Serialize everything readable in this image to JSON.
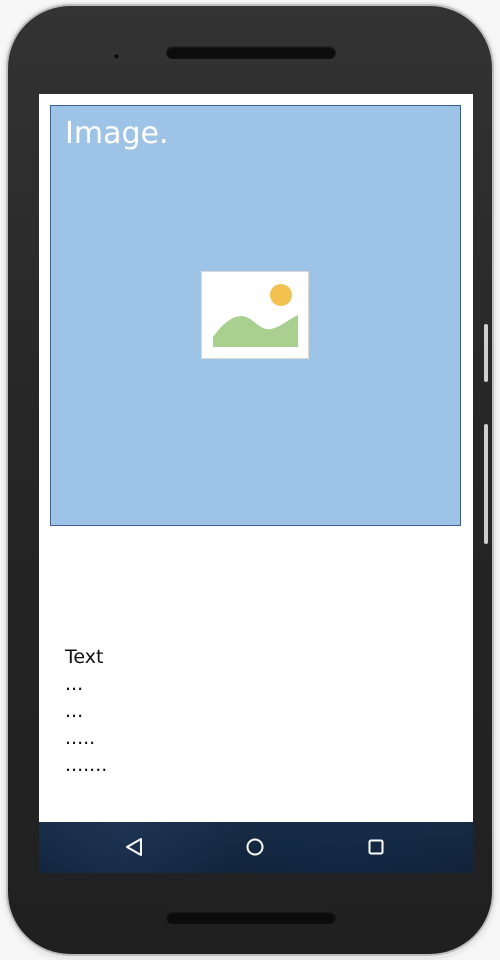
{
  "image_placeholder": {
    "label": "Image.",
    "icon": "image-icon",
    "colors": {
      "background": "#9dc3e6",
      "border": "#3b5f8f",
      "sun": "#f2c14e",
      "hill": "#a9d08e"
    }
  },
  "text_block": {
    "lines": [
      "Text",
      "...",
      "...",
      ".....",
      "......."
    ]
  },
  "nav_bar": {
    "back_icon": "back-triangle-icon",
    "home_icon": "home-circle-icon",
    "recent_icon": "recent-square-icon"
  }
}
